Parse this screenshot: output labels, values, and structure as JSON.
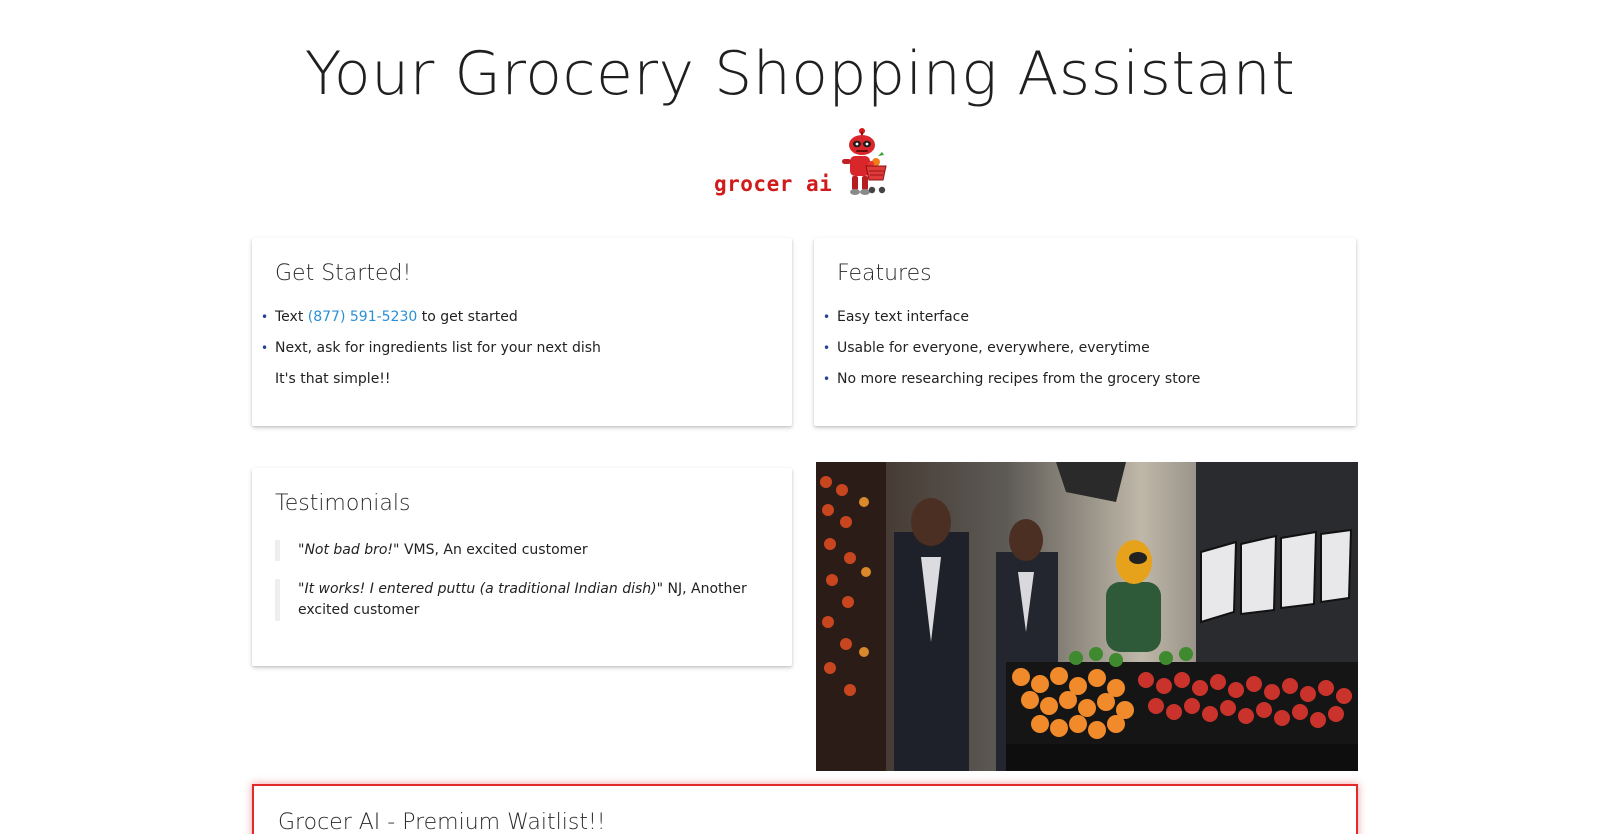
{
  "hero": {
    "title": "Your Grocery Shopping Assistant"
  },
  "logo": {
    "text": "grocer ai",
    "brand_color": "#d11a1a"
  },
  "get_started": {
    "title": "Get Started!",
    "step1_prefix": "Text",
    "phone": "(877) 591-5230",
    "step1_suffix": "to get started",
    "step2": "Next, ask for ingredients list for your next dish",
    "closing": "It's that simple!!"
  },
  "features": {
    "title": "Features",
    "items": [
      "Easy text interface",
      "Usable for everyone, everywhere, everytime",
      "No more researching recipes from the grocery store"
    ]
  },
  "testimonials": {
    "title": "Testimonials",
    "items": [
      {
        "quote": "\"Not bad bro!\"",
        "author": "VMS, An excited customer"
      },
      {
        "quote": "\"It works! I entered puttu (a traditional Indian dish)\"",
        "author": "NJ, Another excited customer"
      }
    ]
  },
  "premium": {
    "title": "Grocer AI - Premium Waitlist!!",
    "border_color": "#e22a2a"
  },
  "colors": {
    "link": "#2a8fd6",
    "bullet": "#26409a"
  }
}
